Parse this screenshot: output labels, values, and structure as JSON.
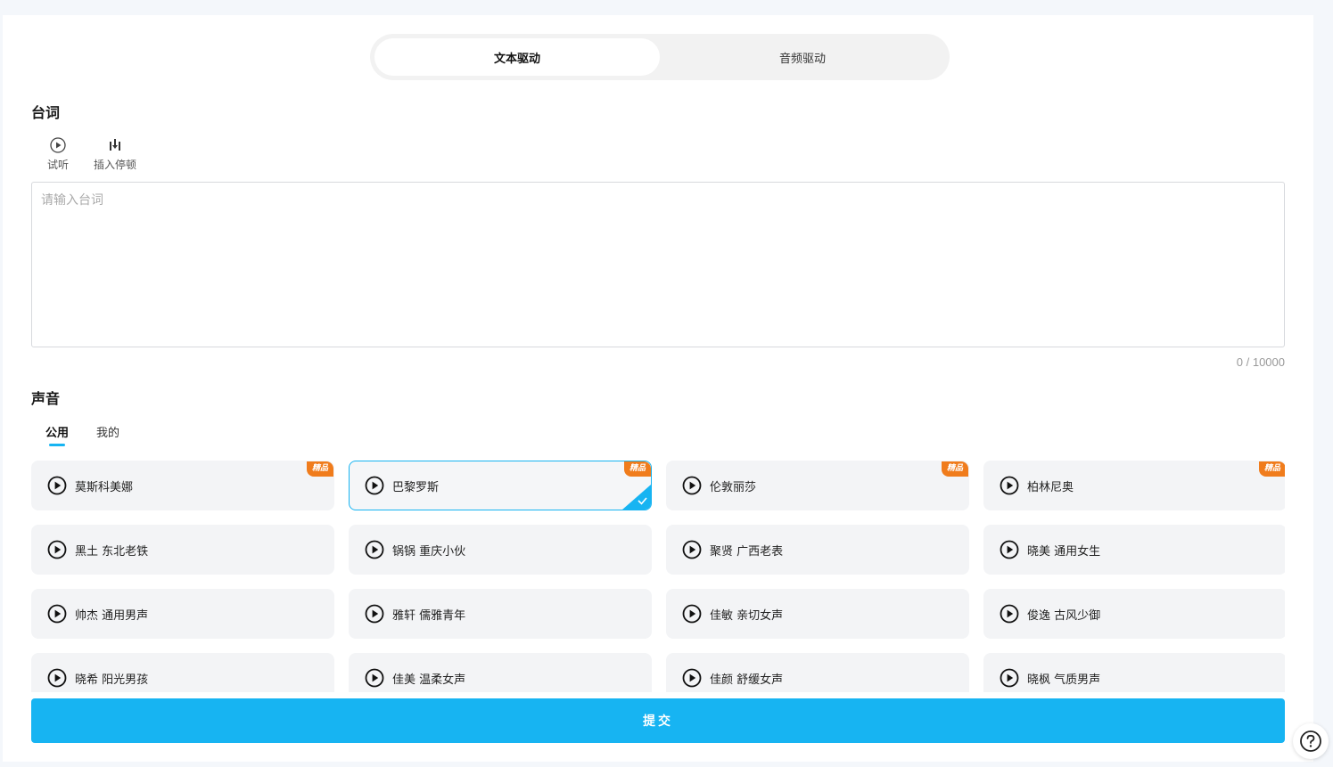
{
  "mode_tabs": {
    "text_driven": "文本驱动",
    "audio_driven": "音频驱动",
    "active": "text_driven"
  },
  "script": {
    "title": "台词",
    "tool_preview": "试听",
    "tool_pause": "插入停顿",
    "placeholder": "请输入台词",
    "value": "",
    "counter": "0 / 10000"
  },
  "voice": {
    "title": "声音",
    "tab_public": "公用",
    "tab_mine": "我的",
    "active_tab": "public",
    "premium_label": "精品",
    "selected_index": 1,
    "cards": [
      {
        "name": "莫斯科美娜",
        "premium": true
      },
      {
        "name": "巴黎罗斯",
        "premium": true
      },
      {
        "name": "伦敦丽莎",
        "premium": true
      },
      {
        "name": "柏林尼奥",
        "premium": true
      },
      {
        "name": "黑土 东北老铁",
        "premium": false
      },
      {
        "name": "锅锅 重庆小伙",
        "premium": false
      },
      {
        "name": "聚贤 广西老表",
        "premium": false
      },
      {
        "name": "晓美 通用女生",
        "premium": false
      },
      {
        "name": "帅杰 通用男声",
        "premium": false
      },
      {
        "name": "雅轩 儒雅青年",
        "premium": false
      },
      {
        "name": "佳敏 亲切女声",
        "premium": false
      },
      {
        "name": "俊逸 古风少御",
        "premium": false
      },
      {
        "name": "晓希 阳光男孩",
        "premium": false
      },
      {
        "name": "佳美 温柔女声",
        "premium": false
      },
      {
        "name": "佳颜 舒缓女声",
        "premium": false
      },
      {
        "name": "晓枫 气质男声",
        "premium": false
      }
    ]
  },
  "submit_label": "提交",
  "colors": {
    "accent": "#17b4f2",
    "premium": "#f07c1c",
    "card_bg": "#f3f4f6"
  }
}
